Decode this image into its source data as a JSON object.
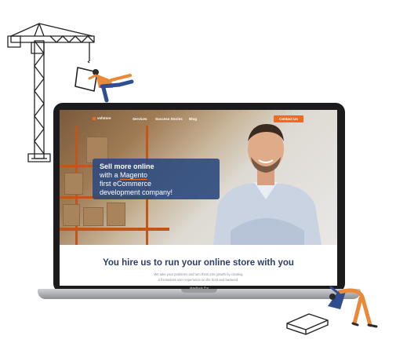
{
  "site": {
    "logo_text": "vsfstore",
    "nav": [
      "Services",
      "Success Stories",
      "Blog"
    ],
    "contact_button": "Contact Us"
  },
  "hero": {
    "line1": "Sell more online",
    "line2_prefix": "with a ",
    "line2_highlight": "Magento",
    "line3_prefix": "first ",
    "line3_highlight": "eCommerce",
    "line4": "development company!"
  },
  "section": {
    "headline": "You hire us to run your online store with you",
    "sub1": "We take your problems and turn them into growth by creating",
    "sub2": "a frictionless user experience on the front and backend."
  },
  "device": {
    "label": "MacBook Pro"
  },
  "colors": {
    "accent": "#f26b1d",
    "card": "#2c4a7e",
    "headline": "#2c3e66",
    "worker_shirt": "#e98a3a",
    "worker_pants": "#2f4d8f"
  }
}
